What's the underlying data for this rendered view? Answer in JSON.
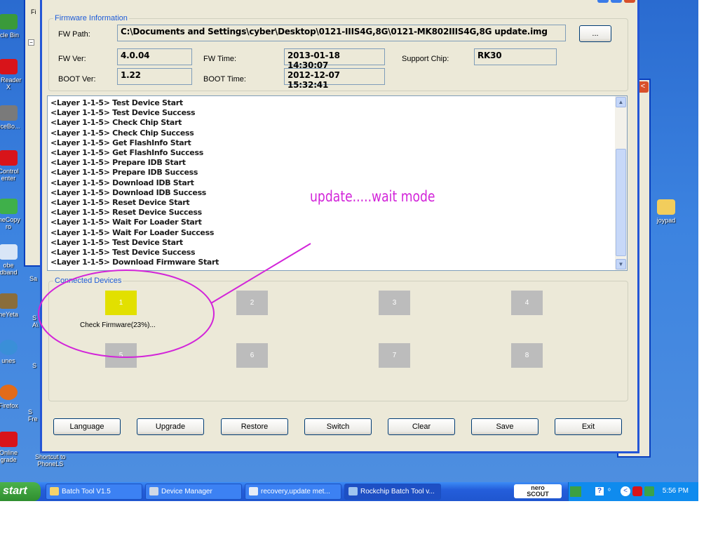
{
  "desktop": {
    "icons": [
      {
        "label": "rcle Bin",
        "icon": "recycle-bin-icon",
        "color": "#3a9a3a"
      },
      {
        "label": "e Reader\nX",
        "icon": "adobe-reader-icon",
        "color": "#d8141a"
      },
      {
        "label": "nceBo...",
        "icon": "balance-board-icon",
        "color": "#7a7a7a"
      },
      {
        "label": "Control\nenter",
        "icon": "avira-icon",
        "color": "#d8141a"
      },
      {
        "label": "meCopy\nro",
        "icon": "gamecopy-icon",
        "color": "#3fb04a"
      },
      {
        "label": "obe\ndband",
        "icon": "broadband-icon",
        "color": "#d9e6f7"
      },
      {
        "label": "neYeta",
        "icon": "app-icon",
        "color": "#8a6d3b"
      },
      {
        "label": "unes",
        "icon": "itunes-icon",
        "color": "#3a8fd8"
      },
      {
        "label": "Firefox",
        "icon": "firefox-icon",
        "color": "#e26b1a"
      },
      {
        "label": "Online\ngrade",
        "icon": "online-upgrade-icon",
        "color": "#d8141a"
      }
    ],
    "shortcuts": [
      "Sa",
      "S\nA\\",
      "S",
      "S\nFre",
      "Shortcut to\nPhoneLS"
    ],
    "right_icon": {
      "label": "joypad",
      "icon": "folder-icon"
    }
  },
  "firmware_info": {
    "legend": "Firmware Information",
    "fw_path_label": "FW Path:",
    "fw_path": "C:\\Documents and Settings\\cyber\\Desktop\\0121-IIIS4G,8G\\0121-MK802IIIS4G,8G update.img",
    "browse_label": "...",
    "fw_ver_label": "FW Ver:",
    "fw_ver": "4.0.04",
    "fw_time_label": "FW Time:",
    "fw_time": "2013-01-18 14:30:07",
    "support_chip_label": "Support Chip:",
    "support_chip": "RK30",
    "boot_ver_label": "BOOT Ver:",
    "boot_ver": "1.22",
    "boot_time_label": "BOOT Time:",
    "boot_time": "2012-12-07 15:32:41"
  },
  "log": [
    "<Layer 1-1-5> Test Device Start",
    "<Layer 1-1-5> Test Device Success",
    "<Layer 1-1-5> Check Chip Start",
    "<Layer 1-1-5> Check Chip Success",
    "<Layer 1-1-5> Get FlashInfo Start",
    "<Layer 1-1-5> Get FlashInfo Success",
    "<Layer 1-1-5> Prepare IDB Start",
    "<Layer 1-1-5> Prepare IDB Success",
    "<Layer 1-1-5> Download IDB Start",
    "<Layer 1-1-5> Download IDB Success",
    "<Layer 1-1-5> Reset Device Start",
    "<Layer 1-1-5> Reset Device Success",
    "<Layer 1-1-5> Wait For Loader Start",
    "<Layer 1-1-5> Wait For Loader Success",
    "<Layer 1-1-5> Test Device Start",
    "<Layer 1-1-5> Test Device Success",
    "<Layer 1-1-5> Download Firmware Start"
  ],
  "devices": {
    "legend": "Connected Devices",
    "items": [
      {
        "label": "1",
        "status": "Check Firmware(23%)...",
        "active": true
      },
      {
        "label": "2",
        "status": "",
        "active": false
      },
      {
        "label": "3",
        "status": "",
        "active": false
      },
      {
        "label": "4",
        "status": "",
        "active": false
      },
      {
        "label": "5",
        "status": "",
        "active": false
      },
      {
        "label": "6",
        "status": "",
        "active": false
      },
      {
        "label": "7",
        "status": "",
        "active": false
      },
      {
        "label": "8",
        "status": "",
        "active": false
      }
    ]
  },
  "buttons": {
    "language": "Language",
    "upgrade": "Upgrade",
    "restore": "Restore",
    "switch": "Switch",
    "clear": "Clear",
    "save": "Save",
    "exit": "Exit"
  },
  "annotation": {
    "text": "update.....wait mode",
    "color": "#d224d9"
  },
  "taskbar": {
    "start_label": "start",
    "tasks": [
      {
        "label": "Batch Tool V1.5",
        "icon": "folder-icon"
      },
      {
        "label": "Device Manager",
        "icon": "device-manager-icon"
      },
      {
        "label": "recovery,update met...",
        "icon": "document-icon"
      },
      {
        "label": "Rockchip Batch Tool v...",
        "icon": "rockchip-icon"
      }
    ],
    "nero_label": "nero\nSCOUT",
    "clock": "5:56 PM"
  },
  "colors": {
    "accent": "#1d5bd8",
    "device_active": "#e2e000",
    "device_idle": "#bcbcbc"
  }
}
